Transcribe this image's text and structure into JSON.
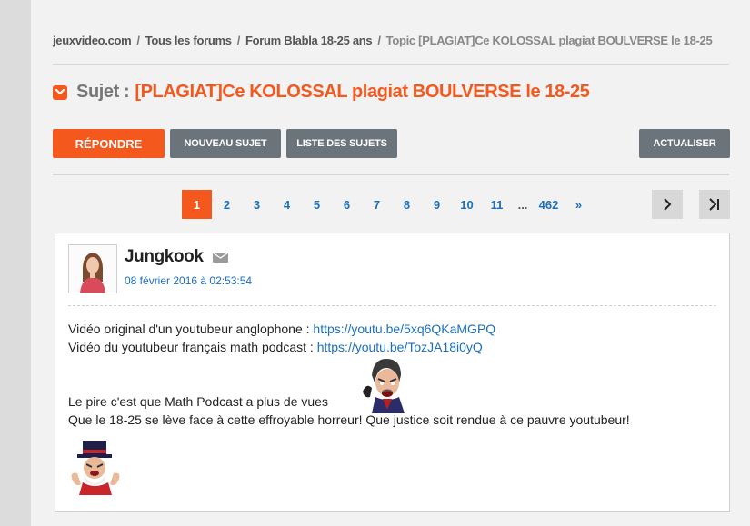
{
  "breadcrumb": {
    "items": [
      "jeuxvideo.com",
      "Tous les forums",
      "Forum Blabla 18-25 ans"
    ],
    "separator": "/",
    "current": "Topic [PLAGIAT]Ce KOLOSSAL plagiat BOULVERSE le 18-25"
  },
  "topic": {
    "subject_label": "Sujet :",
    "title": "[PLAGIAT]Ce KOLOSSAL plagiat BOULVERSE le 18-25"
  },
  "toolbar": {
    "reply_label": "RÉPONDRE",
    "new_topic_label": "NOUVEAU SUJET",
    "topic_list_label": "LISTE DES SUJETS",
    "refresh_label": "ACTUALISER"
  },
  "pagination": {
    "pages": [
      "1",
      "2",
      "3",
      "4",
      "5",
      "6",
      "7",
      "8",
      "9",
      "10",
      "11"
    ],
    "current": "1",
    "ellipsis": "...",
    "last": "462",
    "more": "»"
  },
  "post": {
    "author": "Jungkook",
    "date": "08 février 2016 à 02:53:54",
    "line1_text": "Vidéo original d'un youtubeur anglophone : ",
    "line1_link": "https://youtu.be/5xq6QKaMGPQ",
    "line2_text": "Vidéo du youtubeur français math podcast : ",
    "line2_link": "https://youtu.be/TozJA18i0yQ",
    "line3_text": "Le pire c'est que Math Podcast a plus de vues",
    "line4_text": "Que le 18-25 se lève face à cette effroyable horreur! Que justice soit rendue à ce pauvre youtubeur!"
  },
  "colors": {
    "accent": "#f5581d",
    "link": "#1a6fbf",
    "button_gray": "#6b737b"
  },
  "icons": [
    "chevron-down-icon",
    "mail-icon",
    "chevron-right-icon",
    "last-page-icon"
  ]
}
